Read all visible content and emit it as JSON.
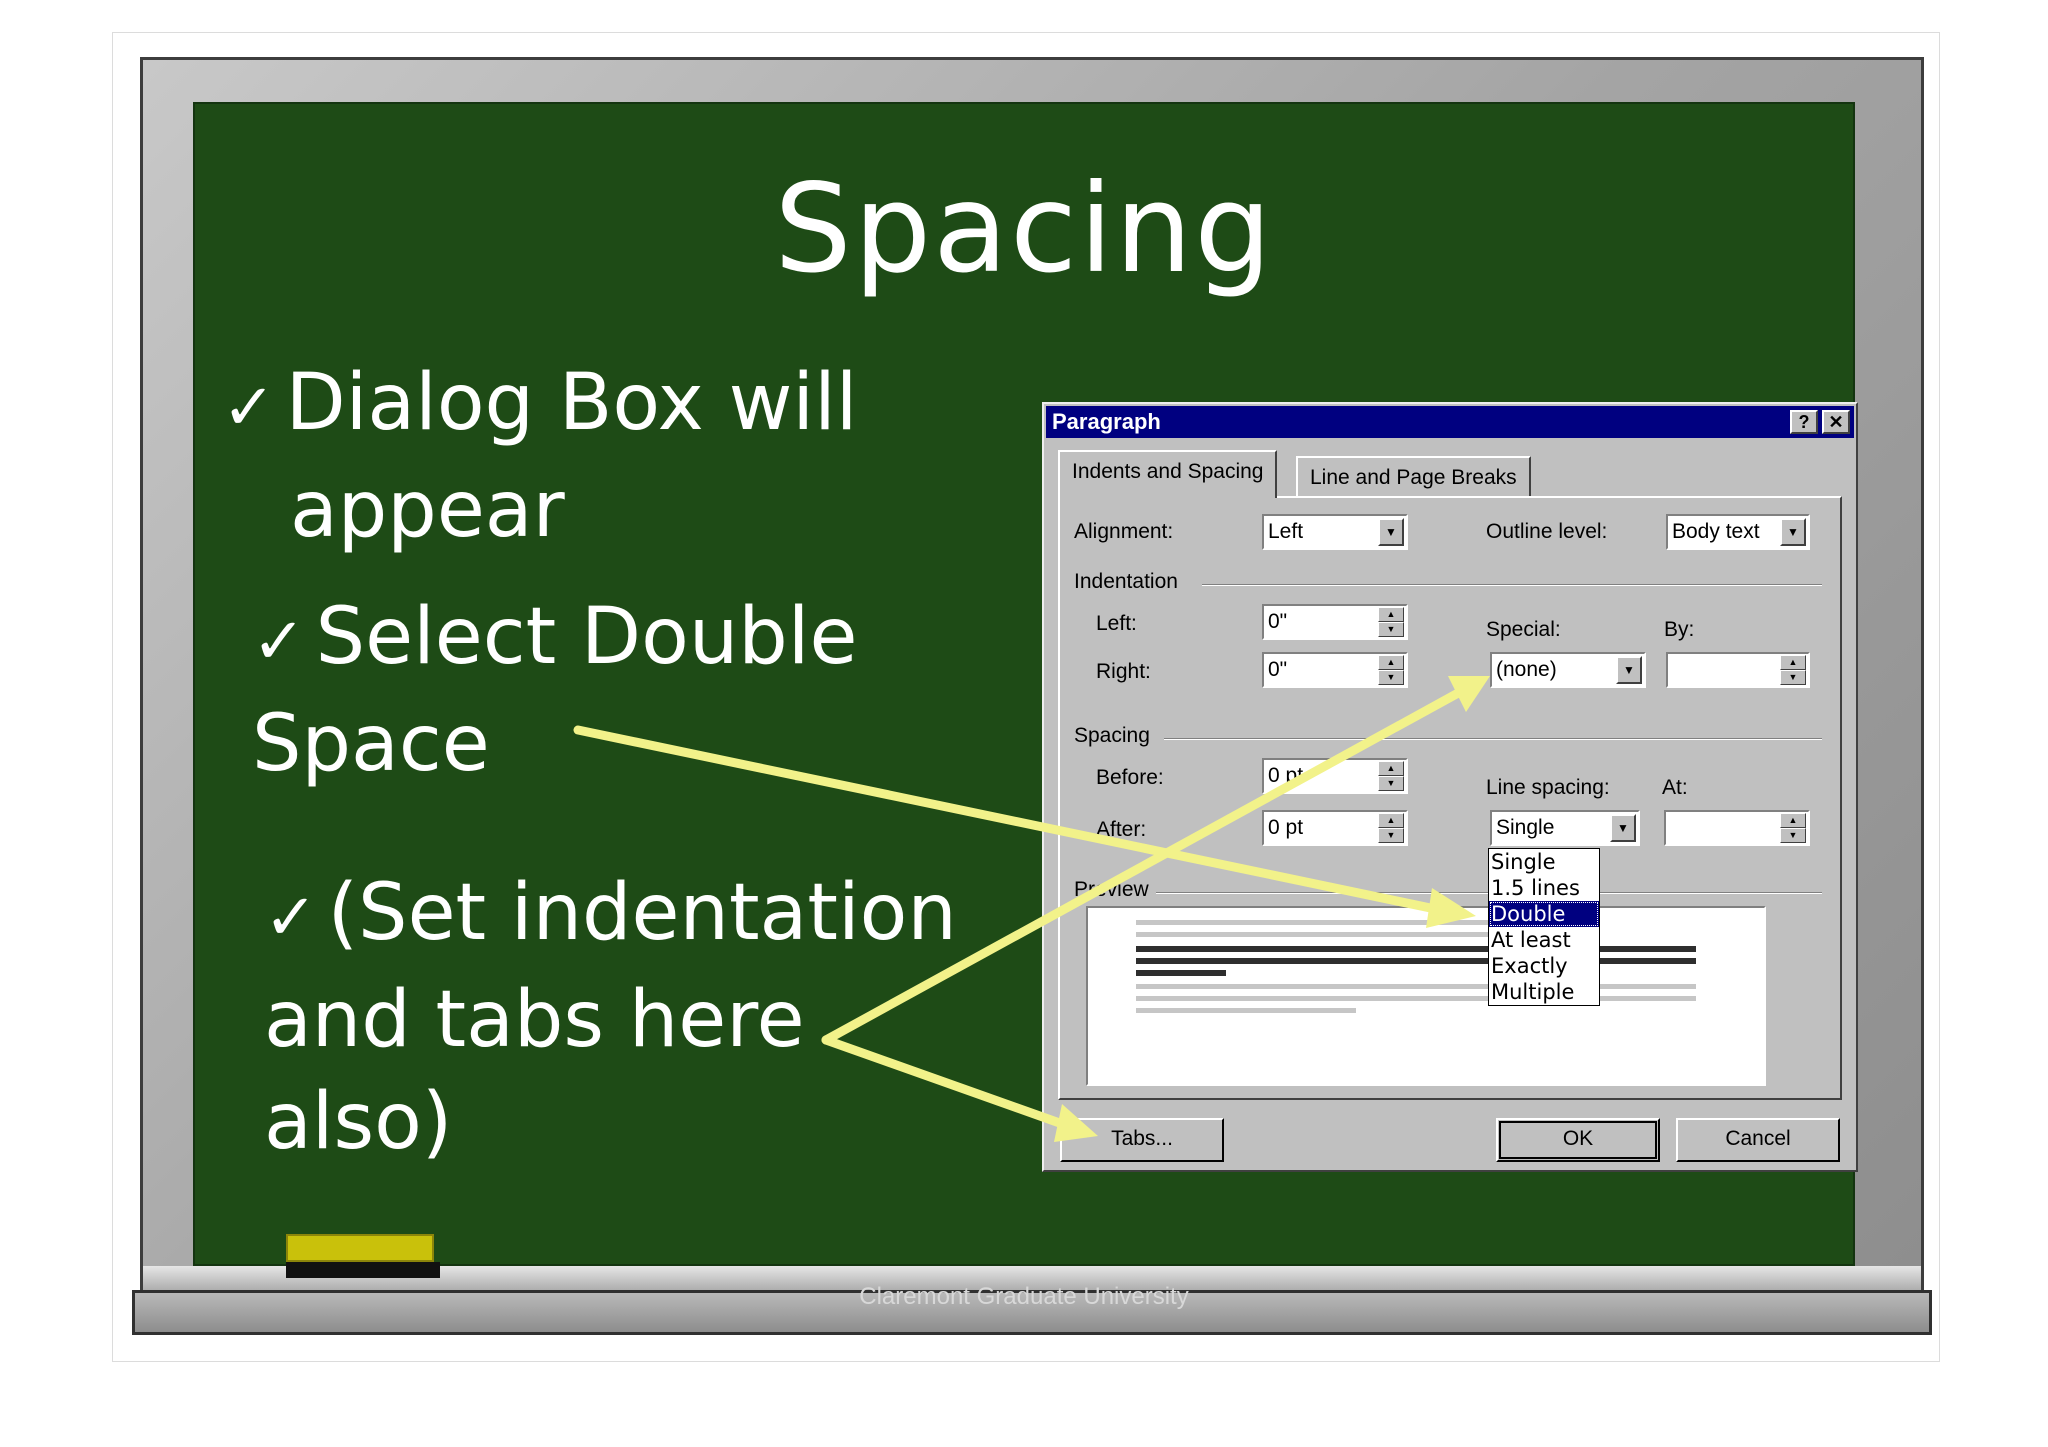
{
  "slide": {
    "title": "Spacing",
    "bullets": [
      {
        "check": "✓",
        "line1": "Dialog Box will",
        "line2": "appear"
      },
      {
        "check": "✓",
        "line1": "Select Double",
        "line2": "Space"
      },
      {
        "check": "✓",
        "line1": "(Set indentation",
        "line2": "and tabs here",
        "line3": "also)"
      }
    ],
    "footer": "Claremont Graduate University"
  },
  "dialog": {
    "title": "Paragraph",
    "help_label": "?",
    "close_label": "✕",
    "tabs": [
      "Indents and Spacing",
      "Line and Page Breaks"
    ],
    "alignment": {
      "label": "Alignment:",
      "value": "Left"
    },
    "outline_level": {
      "label": "Outline level:",
      "value": "Body text"
    },
    "indentation": {
      "group_label": "Indentation",
      "left_label": "Left:",
      "left_value": "0\"",
      "right_label": "Right:",
      "right_value": "0\"",
      "special_label": "Special:",
      "special_value": "(none)",
      "by_label": "By:",
      "by_value": ""
    },
    "spacing": {
      "group_label": "Spacing",
      "before_label": "Before:",
      "before_value": "0 pt",
      "after_label": "After:",
      "after_value": "0 pt",
      "line_spacing_label": "Line spacing:",
      "line_spacing_value": "Single",
      "at_label": "At:",
      "at_value": "",
      "options": [
        "Single",
        "1.5 lines",
        "Double",
        "At least",
        "Exactly",
        "Multiple"
      ],
      "selected": "Double"
    },
    "preview_label": "Preview",
    "buttons": {
      "tabs": "Tabs...",
      "ok": "OK",
      "cancel": "Cancel"
    }
  },
  "colors": {
    "board": "#1e4b16",
    "arrow": "#f2f28a",
    "titlebar": "#000080",
    "dialog_face": "#c0c0c0"
  }
}
